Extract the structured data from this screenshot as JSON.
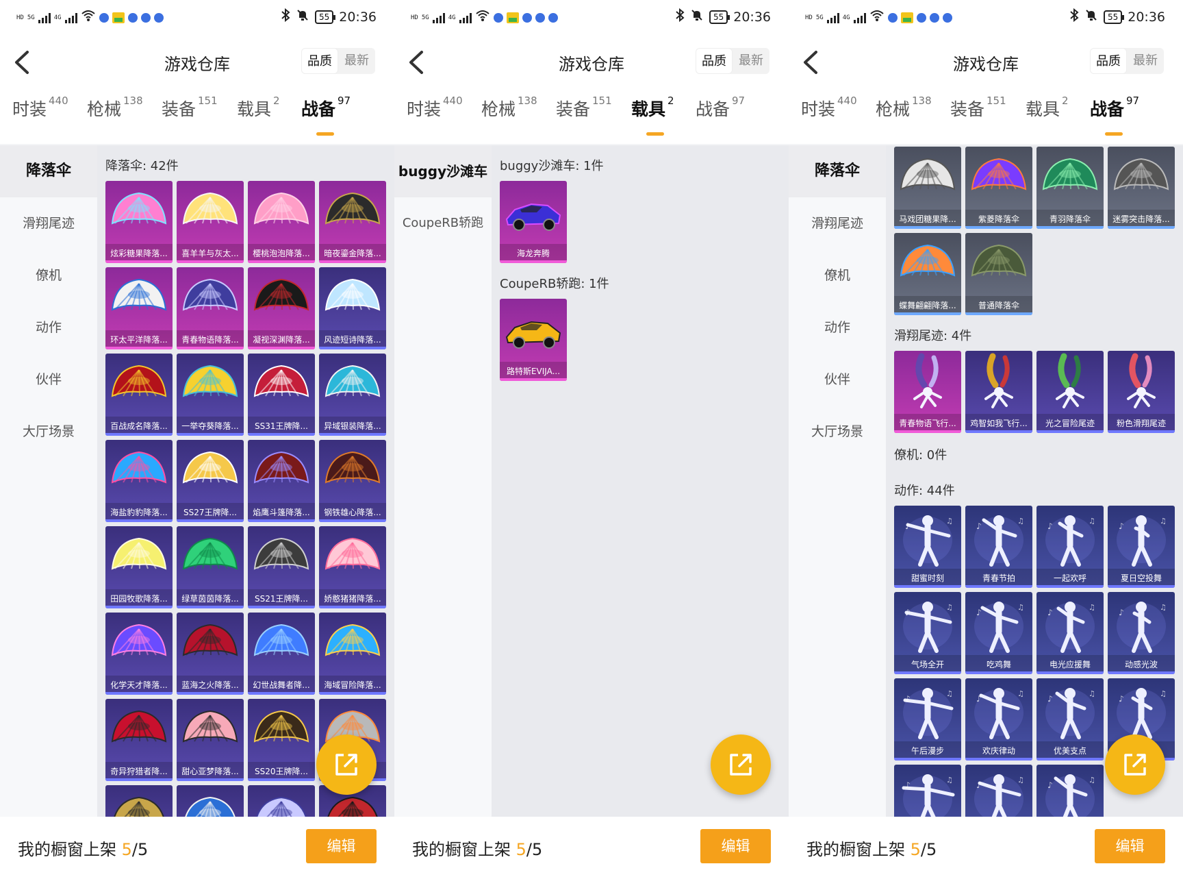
{
  "status_bar": {
    "time": "20:36",
    "battery": "55",
    "net_5g": "5G",
    "net_4g": "4G",
    "hd": "HD"
  },
  "header": {
    "title": "游戏仓库",
    "sort_quality": "品质",
    "sort_newest": "最新"
  },
  "tabs": [
    {
      "label": "时装",
      "count": "440"
    },
    {
      "label": "枪械",
      "count": "138"
    },
    {
      "label": "装备",
      "count": "151"
    },
    {
      "label": "载具",
      "count": "2"
    },
    {
      "label": "战备",
      "count": "97"
    }
  ],
  "bottom": {
    "text": "我的橱窗上架",
    "current": "5",
    "separator": "/",
    "total": "5",
    "edit_label": "编辑"
  },
  "panel1": {
    "active_tab": 4,
    "sidebar": [
      "降落伞",
      "滑翔尾迹",
      "僚机",
      "动作",
      "伙伴",
      "大厅场景"
    ],
    "sidebar_active": 0,
    "section_title": "降落伞: 42件",
    "items": [
      "炫彩糖果降落...",
      "喜羊羊与灰太...",
      "樱桃泡泡降落...",
      "暗夜鎏金降落...",
      "环太平洋降落...",
      "青春物语降落...",
      "凝视深渊降落...",
      "风迹短诗降落...",
      "百战成名降落...",
      "一举夺葵降落...",
      "SS31王牌降...",
      "异域银装降落...",
      "海盐豹豹降落...",
      "SS27王牌降...",
      "焰鹰斗篷降落...",
      "钢铁雄心降落...",
      "田园牧歌降落...",
      "绿草茵茵降落...",
      "SS21王牌降...",
      "娇憨猪猪降落...",
      "化学天才降落...",
      "蓝海之火降落...",
      "幻世战舞者降...",
      "海域冒险降落...",
      "奇异狩猎者降...",
      "甜心亚梦降落...",
      "SS20王牌降...",
      ""
    ]
  },
  "panel2": {
    "active_tab": 3,
    "sidebar": [
      "buggy沙滩车",
      "CoupeRB轿跑"
    ],
    "sidebar_active": 0,
    "sections": [
      {
        "title": "buggy沙滩车: 1件",
        "items": [
          "海龙奔腾"
        ]
      },
      {
        "title": "CoupeRB轿跑: 1件",
        "items": [
          "路特斯EVIJA..."
        ]
      }
    ]
  },
  "panel3": {
    "active_tab": 4,
    "sidebar": [
      "降落伞",
      "滑翔尾迹",
      "僚机",
      "动作",
      "伙伴",
      "大厅场景"
    ],
    "sidebar_active": 0,
    "parachutes": [
      "马戏团糖果降...",
      "紫菱降落伞",
      "青羽降落伞",
      "迷雾突击降落...",
      "蝶舞翩翩降落...",
      "普通降落伞"
    ],
    "trail_title": "滑翔尾迹: 4件",
    "trails": [
      "青春物语飞行...",
      "鸡智如我飞行...",
      "光之冒险尾迹",
      "粉色滑翔尾迹"
    ],
    "wingman_title": "僚机: 0件",
    "action_title": "动作: 44件",
    "actions": [
      "甜蜜时刻",
      "青春节拍",
      "一起欢呼",
      "夏日空投舞",
      "气场全开",
      "吃鸡舞",
      "电光应援舞",
      "动感光波",
      "午后漫步",
      "欢庆律动",
      "优美支点",
      "",
      "",
      "",
      ""
    ]
  },
  "colors": {
    "accent": "#f5a623",
    "fab": "#f5b716",
    "pink_card": "#c33cb3",
    "purple_card": "#5a4bb0",
    "grey_card": "#6c7385"
  }
}
